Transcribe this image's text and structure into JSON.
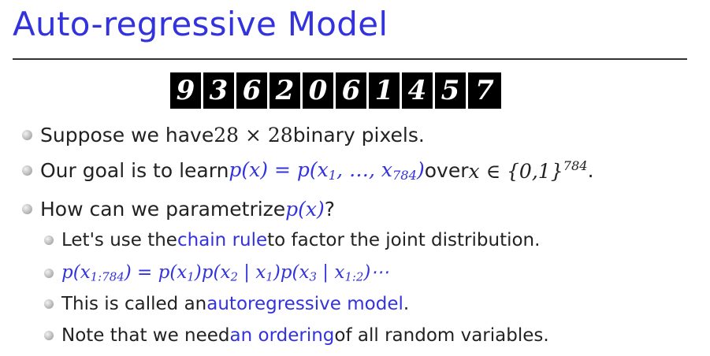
{
  "title": "Auto-regressive Model",
  "digits": [
    "9",
    "3",
    "6",
    "2",
    "0",
    "6",
    "1",
    "4",
    "5",
    "7"
  ],
  "bullets": {
    "b1": {
      "pre": "Suppose we have ",
      "math": "28 × 28",
      "post": " binary pixels."
    },
    "b2": {
      "pre": "Our goal is to learn ",
      "math_p": "p(x) = p(x",
      "math_x1": "1",
      "math_mid": ", …, x",
      "math_x784": "784",
      "math_close": ")",
      "mid": " over ",
      "math_x": "x",
      "math_in": " ∈ {0,1}",
      "math_sup": "784",
      "end": "."
    },
    "b3": {
      "pre": "How can we parametrize ",
      "math": "p(x)",
      "post": "?"
    },
    "s1": {
      "pre": "Let's use the ",
      "link": "chain rule",
      "post": " to factor the joint distribution."
    },
    "s2": {
      "eq": "p(x1:784) = p(x1)p(x2 | x1)p(x3 | x1:2)⋯"
    },
    "s3": {
      "pre": "This is called an ",
      "link": "autoregressive model",
      "post": "."
    },
    "s4": {
      "pre": "Note that we need ",
      "link": "an ordering",
      "post": " of all random variables."
    }
  },
  "colors": {
    "accent": "#3333dd",
    "text": "#222222"
  }
}
